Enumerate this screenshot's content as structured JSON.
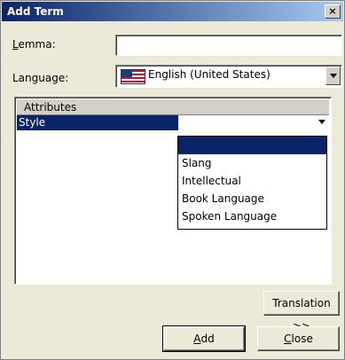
{
  "window": {
    "title": "Add Term",
    "close_glyph": "×"
  },
  "form": {
    "lemma": {
      "label_prefix": "",
      "label_accel": "L",
      "label_rest": "emma:",
      "value": ""
    },
    "language": {
      "label": "Language:",
      "selected": "English (United States)",
      "flag_icon": "us-flag-icon"
    }
  },
  "attributes": {
    "header": "Attributes",
    "rows": [
      {
        "name": "Style",
        "value": ""
      }
    ],
    "style_options": [
      "",
      "Slang",
      "Intellectual",
      "Book Language",
      "Spoken Language"
    ]
  },
  "buttons": {
    "translation": "Translation >>",
    "add_accel": "A",
    "add_rest": "dd",
    "close_accel": "C",
    "close_rest": "lose"
  }
}
